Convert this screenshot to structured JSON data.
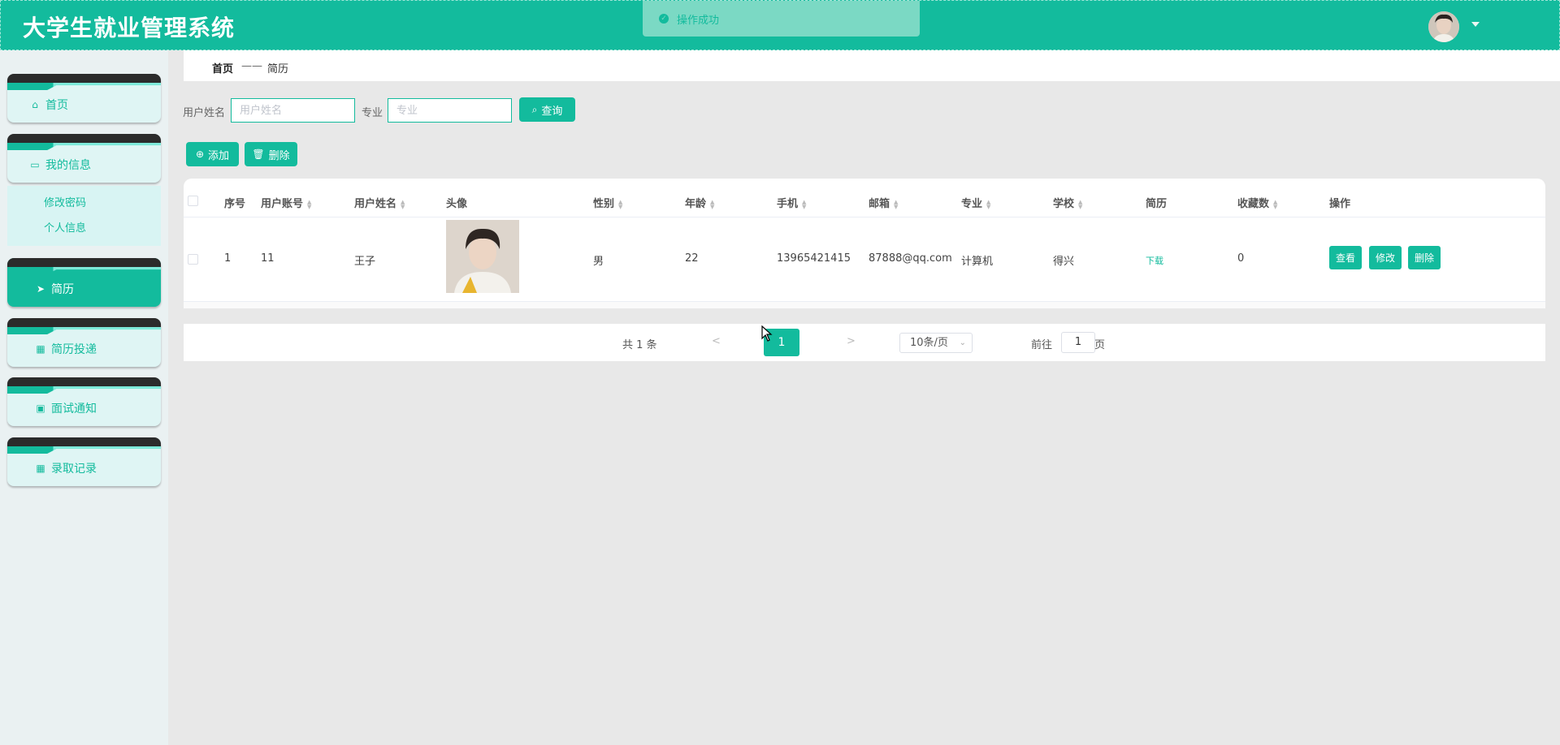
{
  "header": {
    "title": "大学生就业管理系统",
    "toast": "操作成功",
    "avatar_icon": "user-avatar"
  },
  "sidebar": {
    "items": [
      {
        "label": "首页",
        "icon": "home-icon"
      },
      {
        "label": "我的信息",
        "icon": "wallet-icon"
      },
      {
        "label": "简历",
        "icon": "send-icon"
      },
      {
        "label": "简历投递",
        "icon": "grid-icon"
      },
      {
        "label": "面试通知",
        "icon": "chart-icon"
      },
      {
        "label": "录取记录",
        "icon": "grid-icon"
      }
    ],
    "submenu": [
      "修改密码",
      "个人信息"
    ]
  },
  "breadcrumb": {
    "home": "首页",
    "separator": "——",
    "current": "简历"
  },
  "search": {
    "name_label": "用户姓名",
    "name_placeholder": "用户姓名",
    "major_label": "专业",
    "major_placeholder": "专业",
    "query_button": "查询"
  },
  "actions": {
    "add": "添加",
    "delete": "删除"
  },
  "table": {
    "columns": [
      "序号",
      "用户账号",
      "用户姓名",
      "头像",
      "性别",
      "年龄",
      "手机",
      "邮箱",
      "专业",
      "学校",
      "简历",
      "收藏数",
      "操作"
    ],
    "rows": [
      {
        "index": "1",
        "account": "11",
        "name": "王子",
        "gender": "男",
        "age": "22",
        "phone": "13965421415",
        "email": "87888@qq.com",
        "major": "计算机",
        "school": "得兴",
        "resume": "下载",
        "favorites": "0",
        "ops": [
          "查看",
          "修改",
          "删除"
        ]
      }
    ]
  },
  "pagination": {
    "total": "共 1 条",
    "prev": "<",
    "current": "1",
    "next": ">",
    "page_size": "10条/页",
    "goto_label": "前往",
    "goto_value": "1",
    "page_suffix": "页"
  },
  "colors": {
    "primary": "#13bb9d",
    "accent_light": "#7de9d9",
    "card_dark": "#2b2b2b"
  }
}
